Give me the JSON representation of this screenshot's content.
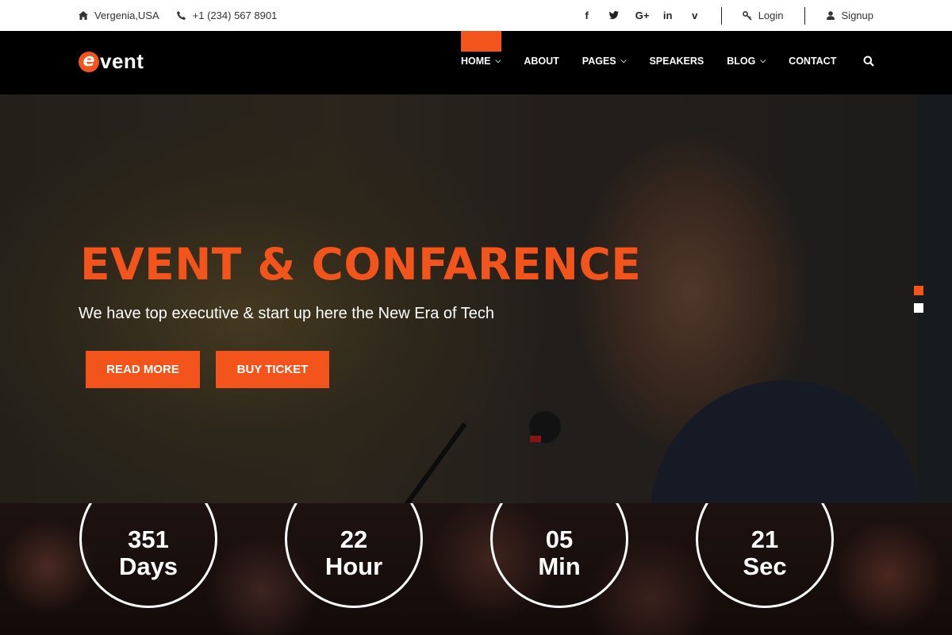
{
  "topbar": {
    "location": "Vergenia,USA",
    "phone": "+1 (234) 567 8901",
    "social": [
      {
        "icon": "facebook-icon",
        "glyph": "f"
      },
      {
        "icon": "twitter-icon",
        "glyph": "𝕥"
      },
      {
        "icon": "google-plus-icon",
        "glyph": "G+"
      },
      {
        "icon": "linkedin-icon",
        "glyph": "in"
      },
      {
        "icon": "vimeo-icon",
        "glyph": "v"
      }
    ],
    "login_label": "Login",
    "signup_label": "Signup"
  },
  "brand": {
    "logo_letter": "e",
    "logo_text": "vent",
    "accent": "#f2541b"
  },
  "nav": {
    "items": [
      {
        "label": "HOME",
        "dropdown": true,
        "active": true
      },
      {
        "label": "ABOUT",
        "dropdown": false
      },
      {
        "label": "PAGES",
        "dropdown": true
      },
      {
        "label": "SPEAKERS",
        "dropdown": false
      },
      {
        "label": "BLOG",
        "dropdown": true
      },
      {
        "label": "CONTACT",
        "dropdown": false
      }
    ],
    "search_icon": "search-icon"
  },
  "hero": {
    "headline": "EVENT & CONFARENCE",
    "subline": "We have top executive & start up here the New Era of Tech",
    "read_more_label": "READ MORE",
    "buy_ticket_label": "BUY TICKET",
    "slides": 2,
    "active_slide": 1
  },
  "countdown": [
    {
      "value": "351",
      "unit": "Days"
    },
    {
      "value": "22",
      "unit": "Hour"
    },
    {
      "value": "05",
      "unit": "Min"
    },
    {
      "value": "21",
      "unit": "Sec"
    }
  ]
}
